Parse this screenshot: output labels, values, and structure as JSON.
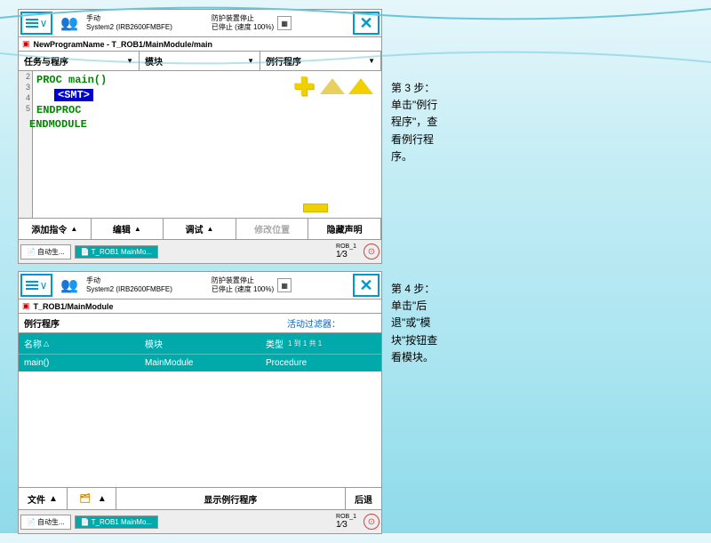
{
  "panel1": {
    "topbar": {
      "device": "手动",
      "system": "System2 (IRB2600FMBFE)",
      "status1": "防护装置停止",
      "status2": "已停止 (速度 100%)"
    },
    "path": "NewProgramName - T_ROB1/MainModule/main",
    "tabs": [
      "任务与程序",
      "模块",
      "例行程序"
    ],
    "code": {
      "line2": "PROC main()",
      "line3": "<SMT>",
      "line4": "ENDPROC",
      "line5": "ENDMODULE"
    },
    "actions": [
      "添加指令",
      "编辑",
      "调试",
      "修改位置",
      "隐藏声明"
    ],
    "bottom_tabs": [
      "自动生...",
      "T_ROB1\nMainMo..."
    ],
    "frac": "ROB_1",
    "frac_num": "1⁄3"
  },
  "panel2": {
    "topbar": {
      "device": "手动",
      "system": "System2 (IRB2600FMBFE)",
      "status1": "防护装置停止",
      "status2": "已停止 (速度 100%)"
    },
    "path": "T_ROB1/MainModule",
    "filter_label": "例行程序",
    "filter_active": "活动过滤器：",
    "headers": [
      "名称",
      "模块",
      "类型"
    ],
    "count": "1 到 1 共 1",
    "row": [
      "main()",
      "MainModule",
      "Procedure"
    ],
    "actions": [
      "文件",
      "",
      "显示例行程序",
      "后退"
    ],
    "bottom_tabs": [
      "自动生...",
      "T_ROB1\nMainMo..."
    ],
    "frac": "ROB_1",
    "frac_num": "1⁄3"
  },
  "steps": {
    "step3": "第 3 步：单击\"例行程序\"，查看例行程序。",
    "step4": "第 4 步：单击\"后退\"或\"模块\"按钮查看模块。"
  }
}
